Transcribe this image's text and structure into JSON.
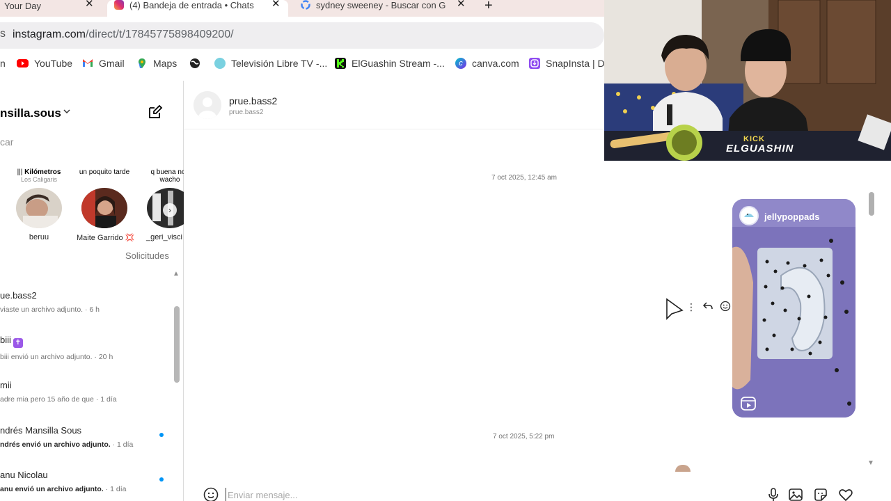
{
  "browser": {
    "tabs": [
      {
        "label": "Your Day",
        "active": false
      },
      {
        "label": "(4) Bandeja de entrada • Chats",
        "active": true
      },
      {
        "label": "sydney sweeney - Buscar con G",
        "active": false
      }
    ],
    "new_tab": "+",
    "close_glyph": "✕",
    "url_domain": "instagram.com",
    "url_path": "/direct/t/17845775898409200/",
    "address_prefix": "s",
    "bookmarks": [
      {
        "label": "n",
        "icon": "bookmark-fragment"
      },
      {
        "label": "YouTube",
        "icon": "youtube-icon"
      },
      {
        "label": "Gmail",
        "icon": "gmail-icon"
      },
      {
        "label": "Maps",
        "icon": "maps-icon"
      },
      {
        "label": "",
        "icon": "globe-icon"
      },
      {
        "label": "Televisión Libre TV -...",
        "icon": "tv-icon"
      },
      {
        "label": "ElGuashin Stream -...",
        "icon": "kick-icon"
      },
      {
        "label": "canva.com",
        "icon": "canva-icon"
      },
      {
        "label": "SnapInsta | Do",
        "icon": "snapinsta-icon"
      }
    ]
  },
  "sidebar": {
    "username": "nsilla.sous",
    "search_fragment": "car",
    "stories": [
      {
        "note_title": "Kilómetros",
        "note_sub": "Los Caligaris",
        "name": "beruu"
      },
      {
        "note_title": "un poquito tarde",
        "note_sub": "",
        "name": "Maite Garrido 💢"
      },
      {
        "note_title": "q buena noc wacho",
        "note_sub": "",
        "name": "_geri_visci"
      }
    ],
    "requests_label": "Solicitudes",
    "conversations": [
      {
        "name": "ue.bass2",
        "preview": "viaste un archivo adjunto.",
        "time": " · 6 h",
        "unread": false
      },
      {
        "name": "biii",
        "preview": "biii envió un archivo adjunto.",
        "time": " · 20 h",
        "unread": false
      },
      {
        "name": "mii",
        "preview": "adre mia pero 15 año de que",
        "time": " · 1 día",
        "unread": false
      },
      {
        "name": "ndrés Mansilla Sous",
        "preview": "ndrés envió un archivo adjunto.",
        "time": " · 1 día",
        "unread": true
      },
      {
        "name": "anu Nicolau",
        "preview": "anu envió un archivo adjunto.",
        "time": " · 1 día",
        "unread": true
      }
    ]
  },
  "chat": {
    "contact_name": "prue.bass2",
    "contact_handle": "prue.bass2",
    "timestamps": [
      "7 oct 2025, 12:45 am",
      "7 oct 2025, 5:22 pm"
    ],
    "reel_user": "jellypoppads",
    "composer_placeholder": "Enviar mensaje..."
  },
  "webcam": {
    "kick_label": "KICK",
    "channel_name": "ELGUASHIN"
  }
}
